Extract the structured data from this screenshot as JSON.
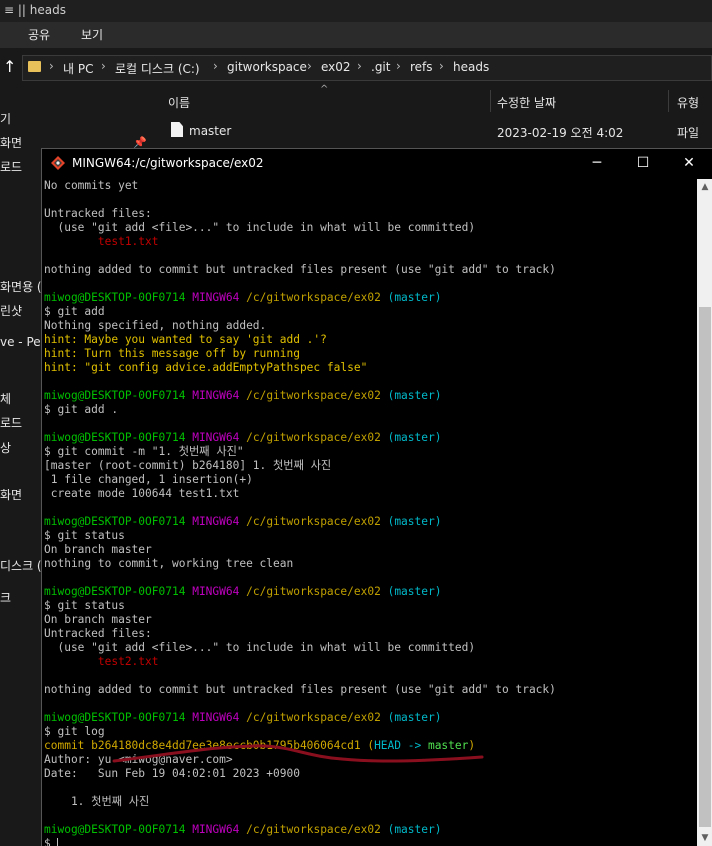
{
  "explorer": {
    "window_title": "heads",
    "title_prefix": "≡ ||",
    "ribbon": [
      "공유",
      "보기"
    ],
    "breadcrumb": [
      "내 PC",
      "로컬 디스크 (C:)",
      "gitworkspace",
      "ex02",
      ".git",
      "refs",
      "heads"
    ],
    "left_items": [
      "기",
      "화면",
      "로드",
      "화면용 (",
      "린샷",
      "ve - Per",
      "체",
      "로드",
      "상",
      "화면",
      "디스크 (",
      "크"
    ],
    "columns": [
      "이름",
      "수정한 날짜",
      "유형"
    ],
    "file": {
      "name": "master",
      "modified": "2023-02-19 오전 4:02",
      "type": "파일"
    }
  },
  "terminal": {
    "title": "MINGW64:/c/gitworkspace/ex02",
    "controls": {
      "minimize": "─",
      "maximize": "☐",
      "close": "✕"
    },
    "prompt": {
      "user": "miwog@DESKTOP-0OF0714",
      "env": "MINGW64",
      "path": "/c/gitworkspace/ex02",
      "branch": "(master)"
    },
    "lines": [
      {
        "segs": [
          {
            "c": "w",
            "t": "No commits yet"
          }
        ]
      },
      {
        "segs": [
          {
            "c": "w",
            "t": ""
          }
        ]
      },
      {
        "segs": [
          {
            "c": "w",
            "t": "Untracked files:"
          }
        ]
      },
      {
        "segs": [
          {
            "c": "w",
            "t": "  (use \"git add <file>...\" to include in what will be committed)"
          }
        ]
      },
      {
        "segs": [
          {
            "c": "rd",
            "t": "        test1.txt"
          }
        ]
      },
      {
        "segs": [
          {
            "c": "w",
            "t": ""
          }
        ]
      },
      {
        "segs": [
          {
            "c": "w",
            "t": "nothing added to commit but untracked files present (use \"git add\" to track)"
          }
        ]
      },
      {
        "segs": [
          {
            "c": "w",
            "t": ""
          }
        ]
      },
      {
        "prompt": true
      },
      {
        "segs": [
          {
            "c": "w",
            "t": "$ git add"
          }
        ]
      },
      {
        "segs": [
          {
            "c": "w",
            "t": "Nothing specified, nothing added."
          }
        ]
      },
      {
        "segs": [
          {
            "c": "hl",
            "t": "hint: Maybe you wanted to say 'git add .'?"
          }
        ]
      },
      {
        "segs": [
          {
            "c": "hl",
            "t": "hint: Turn this message off by running"
          }
        ]
      },
      {
        "segs": [
          {
            "c": "hl",
            "t": "hint: \"git config advice.addEmptyPathspec false\""
          }
        ]
      },
      {
        "segs": [
          {
            "c": "w",
            "t": ""
          }
        ]
      },
      {
        "prompt": true
      },
      {
        "segs": [
          {
            "c": "w",
            "t": "$ git add ."
          }
        ]
      },
      {
        "segs": [
          {
            "c": "w",
            "t": ""
          }
        ]
      },
      {
        "prompt": true
      },
      {
        "segs": [
          {
            "c": "w",
            "t": "$ git commit -m \"1. 첫번째 사진\""
          }
        ]
      },
      {
        "segs": [
          {
            "c": "w",
            "t": "[master (root-commit) b264180] 1. 첫번째 사진"
          }
        ]
      },
      {
        "segs": [
          {
            "c": "w",
            "t": " 1 file changed, 1 insertion(+)"
          }
        ]
      },
      {
        "segs": [
          {
            "c": "w",
            "t": " create mode 100644 test1.txt"
          }
        ]
      },
      {
        "segs": [
          {
            "c": "w",
            "t": ""
          }
        ]
      },
      {
        "prompt": true
      },
      {
        "segs": [
          {
            "c": "w",
            "t": "$ git status"
          }
        ]
      },
      {
        "segs": [
          {
            "c": "w",
            "t": "On branch master"
          }
        ]
      },
      {
        "segs": [
          {
            "c": "w",
            "t": "nothing to commit, working tree clean"
          }
        ]
      },
      {
        "segs": [
          {
            "c": "w",
            "t": ""
          }
        ]
      },
      {
        "prompt": true
      },
      {
        "segs": [
          {
            "c": "w",
            "t": "$ git status"
          }
        ]
      },
      {
        "segs": [
          {
            "c": "w",
            "t": "On branch master"
          }
        ]
      },
      {
        "segs": [
          {
            "c": "w",
            "t": "Untracked files:"
          }
        ]
      },
      {
        "segs": [
          {
            "c": "w",
            "t": "  (use \"git add <file>...\" to include in what will be committed)"
          }
        ]
      },
      {
        "segs": [
          {
            "c": "rd",
            "t": "        test2.txt"
          }
        ]
      },
      {
        "segs": [
          {
            "c": "w",
            "t": ""
          }
        ]
      },
      {
        "segs": [
          {
            "c": "w",
            "t": "nothing added to commit but untracked files present (use \"git add\" to track)"
          }
        ]
      },
      {
        "segs": [
          {
            "c": "w",
            "t": ""
          }
        ]
      },
      {
        "prompt": true
      },
      {
        "segs": [
          {
            "c": "w",
            "t": "$ git log"
          }
        ]
      },
      {
        "segs": [
          {
            "c": "ylw",
            "t": "commit b264180dc8e4dd7ee3e8eccb0b1795b406064cd1 "
          },
          {
            "c": "ylw",
            "t": "("
          },
          {
            "c": "cy",
            "t": "HEAD -> "
          },
          {
            "c": "bgr",
            "t": "master"
          },
          {
            "c": "ylw",
            "t": ")"
          }
        ]
      },
      {
        "segs": [
          {
            "c": "w",
            "t": "Author: yu <miwog@naver.com>"
          }
        ]
      },
      {
        "segs": [
          {
            "c": "w",
            "t": "Date:   Sun Feb 19 04:02:01 2023 +0900"
          }
        ]
      },
      {
        "segs": [
          {
            "c": "w",
            "t": ""
          }
        ]
      },
      {
        "segs": [
          {
            "c": "w",
            "t": "    1. 첫번째 사진"
          }
        ]
      },
      {
        "segs": [
          {
            "c": "w",
            "t": ""
          }
        ]
      },
      {
        "prompt": true
      },
      {
        "segs": [
          {
            "c": "w",
            "t": "$ "
          }
        ],
        "cursor": true
      }
    ]
  },
  "colors": {
    "prompt_user": "#00c000",
    "prompt_env": "#c000c0",
    "prompt_path": "#c0a000",
    "prompt_branch": "#00b8c8",
    "untracked": "#c00000",
    "annotation": "#8a0f1e"
  },
  "icons": {
    "up_arrow": "↑",
    "chevron": "›",
    "pin": "📌",
    "sort_caret": "^",
    "scroll_up": "▲",
    "scroll_down": "▼"
  }
}
